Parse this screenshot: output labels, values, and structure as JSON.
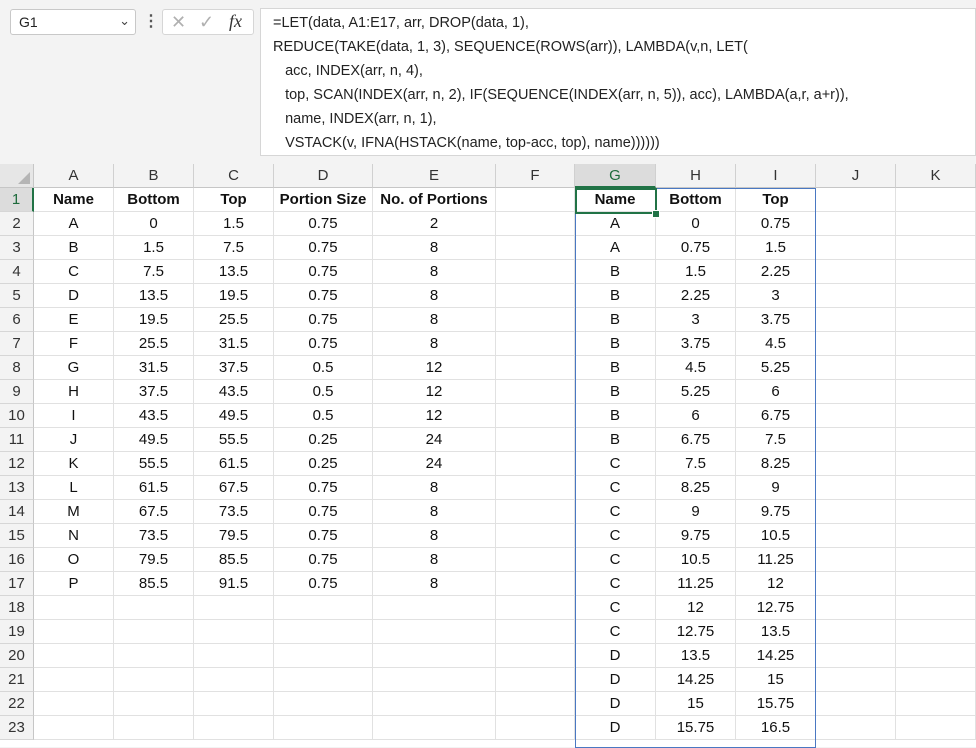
{
  "name_box": "G1",
  "formula_lines": [
    "=LET(data, A1:E17, arr, DROP(data, 1),",
    "REDUCE(TAKE(data, 1, 3), SEQUENCE(ROWS(arr)), LAMBDA(v,n, LET(",
    "   acc, INDEX(arr, n, 4),",
    "   top, SCAN(INDEX(arr, n, 2), IF(SEQUENCE(INDEX(arr, n, 5)), acc), LAMBDA(a,r, a+r)),",
    "   name, INDEX(arr, n, 1),",
    "   VSTACK(v, IFNA(HSTACK(name, top-acc, top), name))))))"
  ],
  "columns": [
    "A",
    "B",
    "C",
    "D",
    "E",
    "F",
    "G",
    "H",
    "I",
    "J",
    "K"
  ],
  "rows": [
    [
      "Name",
      "Bottom",
      "Top",
      "Portion Size",
      "No. of Portions",
      "",
      "Name",
      "Bottom",
      "Top",
      "",
      ""
    ],
    [
      "A",
      "0",
      "1.5",
      "0.75",
      "2",
      "",
      "A",
      "0",
      "0.75",
      "",
      ""
    ],
    [
      "B",
      "1.5",
      "7.5",
      "0.75",
      "8",
      "",
      "A",
      "0.75",
      "1.5",
      "",
      ""
    ],
    [
      "C",
      "7.5",
      "13.5",
      "0.75",
      "8",
      "",
      "B",
      "1.5",
      "2.25",
      "",
      ""
    ],
    [
      "D",
      "13.5",
      "19.5",
      "0.75",
      "8",
      "",
      "B",
      "2.25",
      "3",
      "",
      ""
    ],
    [
      "E",
      "19.5",
      "25.5",
      "0.75",
      "8",
      "",
      "B",
      "3",
      "3.75",
      "",
      ""
    ],
    [
      "F",
      "25.5",
      "31.5",
      "0.75",
      "8",
      "",
      "B",
      "3.75",
      "4.5",
      "",
      ""
    ],
    [
      "G",
      "31.5",
      "37.5",
      "0.5",
      "12",
      "",
      "B",
      "4.5",
      "5.25",
      "",
      ""
    ],
    [
      "H",
      "37.5",
      "43.5",
      "0.5",
      "12",
      "",
      "B",
      "5.25",
      "6",
      "",
      ""
    ],
    [
      "I",
      "43.5",
      "49.5",
      "0.5",
      "12",
      "",
      "B",
      "6",
      "6.75",
      "",
      ""
    ],
    [
      "J",
      "49.5",
      "55.5",
      "0.25",
      "24",
      "",
      "B",
      "6.75",
      "7.5",
      "",
      ""
    ],
    [
      "K",
      "55.5",
      "61.5",
      "0.25",
      "24",
      "",
      "C",
      "7.5",
      "8.25",
      "",
      ""
    ],
    [
      "L",
      "61.5",
      "67.5",
      "0.75",
      "8",
      "",
      "C",
      "8.25",
      "9",
      "",
      ""
    ],
    [
      "M",
      "67.5",
      "73.5",
      "0.75",
      "8",
      "",
      "C",
      "9",
      "9.75",
      "",
      ""
    ],
    [
      "N",
      "73.5",
      "79.5",
      "0.75",
      "8",
      "",
      "C",
      "9.75",
      "10.5",
      "",
      ""
    ],
    [
      "O",
      "79.5",
      "85.5",
      "0.75",
      "8",
      "",
      "C",
      "10.5",
      "11.25",
      "",
      ""
    ],
    [
      "P",
      "85.5",
      "91.5",
      "0.75",
      "8",
      "",
      "C",
      "11.25",
      "12",
      "",
      ""
    ],
    [
      "",
      "",
      "",
      "",
      "",
      "",
      "C",
      "12",
      "12.75",
      "",
      ""
    ],
    [
      "",
      "",
      "",
      "",
      "",
      "",
      "C",
      "12.75",
      "13.5",
      "",
      ""
    ],
    [
      "",
      "",
      "",
      "",
      "",
      "",
      "D",
      "13.5",
      "14.25",
      "",
      ""
    ],
    [
      "",
      "",
      "",
      "",
      "",
      "",
      "D",
      "14.25",
      "15",
      "",
      ""
    ],
    [
      "",
      "",
      "",
      "",
      "",
      "",
      "D",
      "15",
      "15.75",
      "",
      ""
    ],
    [
      "",
      "",
      "",
      "",
      "",
      "",
      "D",
      "15.75",
      "16.5",
      "",
      ""
    ]
  ]
}
